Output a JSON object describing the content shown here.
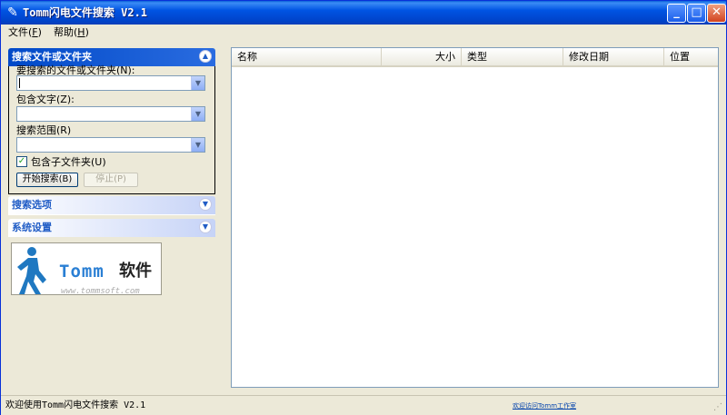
{
  "window": {
    "title": "Tomm闪电文件搜索 V2.1"
  },
  "titlebar_buttons": {
    "minimize": "_",
    "maximize": "□",
    "close": "✕"
  },
  "menu": {
    "items": [
      {
        "label": "文件",
        "accel": "F"
      },
      {
        "label": "帮助",
        "accel": "H"
      }
    ]
  },
  "search_panel": {
    "title": "搜索文件或文件夹",
    "name_label": "要搜索的文件或文件夹(N):",
    "name_value": "",
    "contains_label": "包含文字(Z):",
    "contains_value": "",
    "range_label": "搜索范围(R)",
    "range_value": "",
    "include_subfolders_label": "包含子文件夹(U)",
    "include_subfolders_checked": true,
    "start_button": "开始搜索(B)",
    "stop_button": "停止(P)"
  },
  "options_panel": {
    "title": "搜索选项"
  },
  "settings_panel": {
    "title": "系统设置"
  },
  "logo": {
    "brand": "Tomm",
    "suffix": "软件",
    "url": "www.tommsoft.com"
  },
  "results": {
    "columns": [
      "名称",
      "大小",
      "类型",
      "修改日期",
      "位置"
    ],
    "rows": []
  },
  "status": {
    "text": "欢迎使用Tomm闪电文件搜索 V2.1",
    "link": "欢迎访问Tomm工作室"
  },
  "icons": [
    "app-icon",
    "minimize-icon",
    "maximize-icon",
    "close-icon",
    "chevron-up-icon",
    "chevron-down-icon",
    "combo-arrow-icon",
    "checkbox-check-icon",
    "walking-person-logo-icon",
    "size-grip-icon"
  ]
}
